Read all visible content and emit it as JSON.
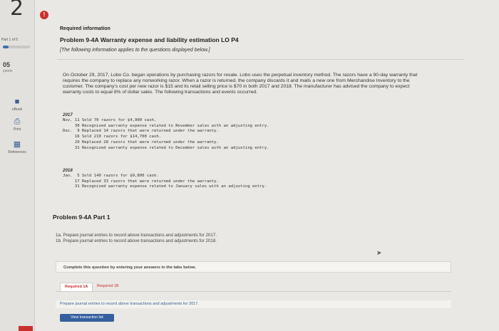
{
  "sidebar": {
    "question_number": "2",
    "part_label": "Part 1 of 5",
    "progress_fraction": 0.2,
    "score": "05",
    "points_label": "points",
    "buttons": [
      {
        "label": "eBook",
        "icon": "book-icon"
      },
      {
        "label": "Print",
        "icon": "print-icon"
      },
      {
        "label": "References",
        "icon": "references-icon"
      }
    ]
  },
  "header": {
    "info_badge": "!",
    "required_info": "Required information",
    "problem_title": "Problem 9-4A Warranty expense and liability estimation LO P4",
    "applies_note": "[The following information applies to the questions displayed below.]"
  },
  "body": {
    "paragraph": "On October 29, 2017, Lobo Co. began operations by purchasing razors for resale. Lobo uses the perpetual inventory method. The razors have a 90-day warranty that requires the company to replace any nonworking razor. When a razor is returned, the company discards it and mails a new one from Merchandise Inventory to the customer. The company's cost per new razor is $15 and its retail selling price is $70 in both 2017 and 2018. The manufacturer has advised the company to expect warranty costs to equal 8% of dollar sales. The following transactions and events occurred.",
    "year1": "2017",
    "rows_2017": [
      "Nov. 11 Sold 70 razors for $4,900 cash.",
      "     30 Recognized warranty expense related to November sales with an adjusting entry.",
      "Dec.  9 Replaced 14 razors that were returned under the warranty.",
      "     16 Sold 210 razors for $14,700 cash.",
      "     29 Replaced 28 razors that were returned under the warranty.",
      "     31 Recognized warranty expense related to December sales with an adjusting entry."
    ],
    "year2": "2018",
    "rows_2018": [
      "Jan.  5 Sold 140 razors for $9,800 cash.",
      "     17 Replaced 33 razors that were returned under the warranty.",
      "     31 Recognized warranty expense related to January sales with an adjusting entry."
    ]
  },
  "part": {
    "title": "Problem 9-4A Part 1",
    "instruction_a": "1a. Prepare journal entries to record above transactions and adjustments for 2017.",
    "instruction_b": "1b. Prepare journal entries to record above transactions and adjustments for 2018.",
    "complete_msg": "Complete this question by entering your answers in the tabs below.",
    "tab1": "Required 1A",
    "tab2": "Required 1B",
    "tab_instruction": "Prepare journal entries to record above transactions and adjustments for 2017.",
    "view_button": "View transaction list"
  }
}
